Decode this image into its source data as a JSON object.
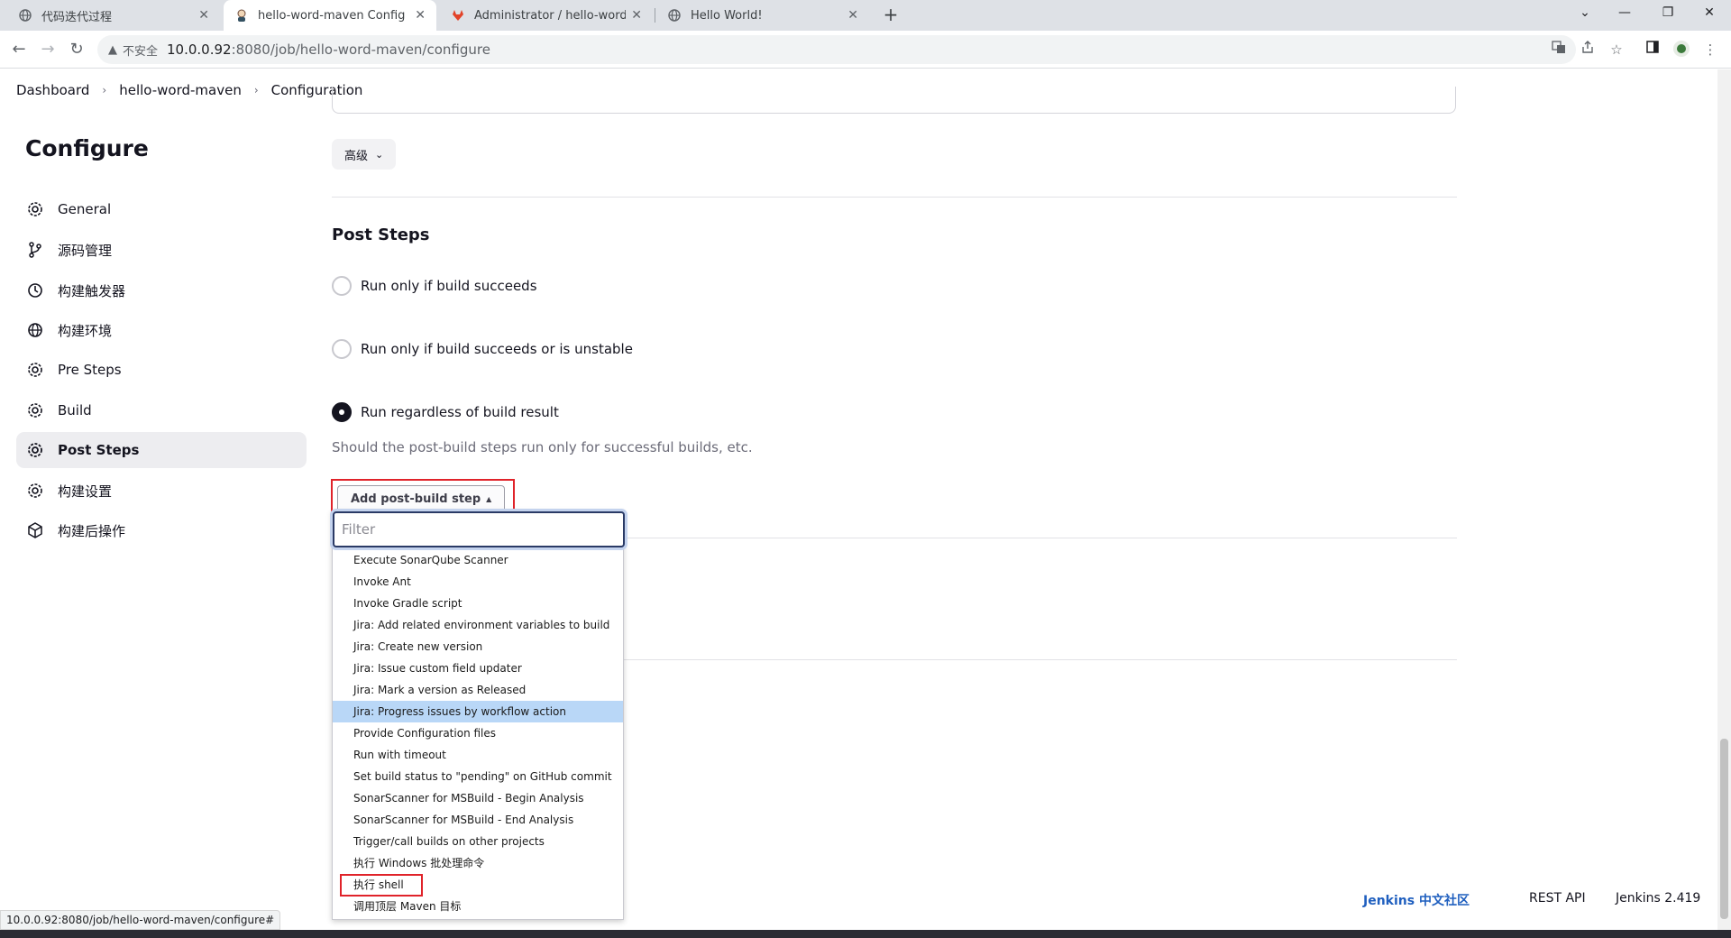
{
  "browser": {
    "tabs": [
      {
        "title": "代码迭代过程",
        "favicon": "globe-icon",
        "active": false
      },
      {
        "title": "hello-word-maven Config [Jenkins]",
        "favicon": "jenkins-icon",
        "active": true
      },
      {
        "title": "Administrator / hello-word · GitLab",
        "favicon": "gitlab-icon",
        "active": false
      },
      {
        "title": "Hello World!",
        "favicon": "globe-icon",
        "active": false
      }
    ],
    "new_tab": "+",
    "security_label": "不安全",
    "url_host": "10.0.0.92",
    "url_rest": ":8080/job/hello-word-maven/configure"
  },
  "breadcrumb": {
    "items": [
      "Dashboard",
      "hello-word-maven",
      "Configuration"
    ]
  },
  "sidebar": {
    "title": "Configure",
    "items": [
      {
        "label": "General",
        "icon": "gear-icon"
      },
      {
        "label": "源码管理",
        "icon": "branch-icon"
      },
      {
        "label": "构建触发器",
        "icon": "clock-icon"
      },
      {
        "label": "构建环境",
        "icon": "globe-icon"
      },
      {
        "label": "Pre Steps",
        "icon": "gear-icon"
      },
      {
        "label": "Build",
        "icon": "gear-icon"
      },
      {
        "label": "Post Steps",
        "icon": "gear-icon"
      },
      {
        "label": "构建设置",
        "icon": "gear-icon"
      },
      {
        "label": "构建后操作",
        "icon": "cube-icon"
      }
    ],
    "active_index": 6
  },
  "main": {
    "advanced_label": "高级",
    "post_steps_title": "Post Steps",
    "radios": [
      {
        "label": "Run only if build succeeds",
        "checked": false
      },
      {
        "label": "Run only if build succeeds or is unstable",
        "checked": false
      },
      {
        "label": "Run regardless of build result",
        "checked": true
      }
    ],
    "help_text": "Should the post-build steps run only for successful builds, etc.",
    "add_step_label": "Add post-build step"
  },
  "dropdown": {
    "filter_placeholder": "Filter",
    "items": [
      "Execute SonarQube Scanner",
      "Invoke Ant",
      "Invoke Gradle script",
      "Jira: Add related environment variables to build",
      "Jira: Create new version",
      "Jira: Issue custom field updater",
      "Jira: Mark a version as Released",
      "Jira: Progress issues by workflow action",
      "Provide Configuration files",
      "Run with timeout",
      "Set build status to \"pending\" on GitHub commit",
      "SonarScanner for MSBuild - Begin Analysis",
      "SonarScanner for MSBuild - End Analysis",
      "Trigger/call builds on other projects",
      "执行 Windows 批处理命令",
      "执行 shell",
      "调用顶层 Maven 目标"
    ],
    "highlighted_index": 7,
    "red_boxed_index": 15
  },
  "footer": {
    "community": "Jenkins 中文社区",
    "rest_api": "REST API",
    "version": "Jenkins 2.419"
  },
  "status_url": "10.0.0.92:8080/job/hello-word-maven/configure#",
  "colors": {
    "accent_red": "#e0232a",
    "link_blue": "#1f5fbf",
    "highlight": "#b9d7f7"
  }
}
